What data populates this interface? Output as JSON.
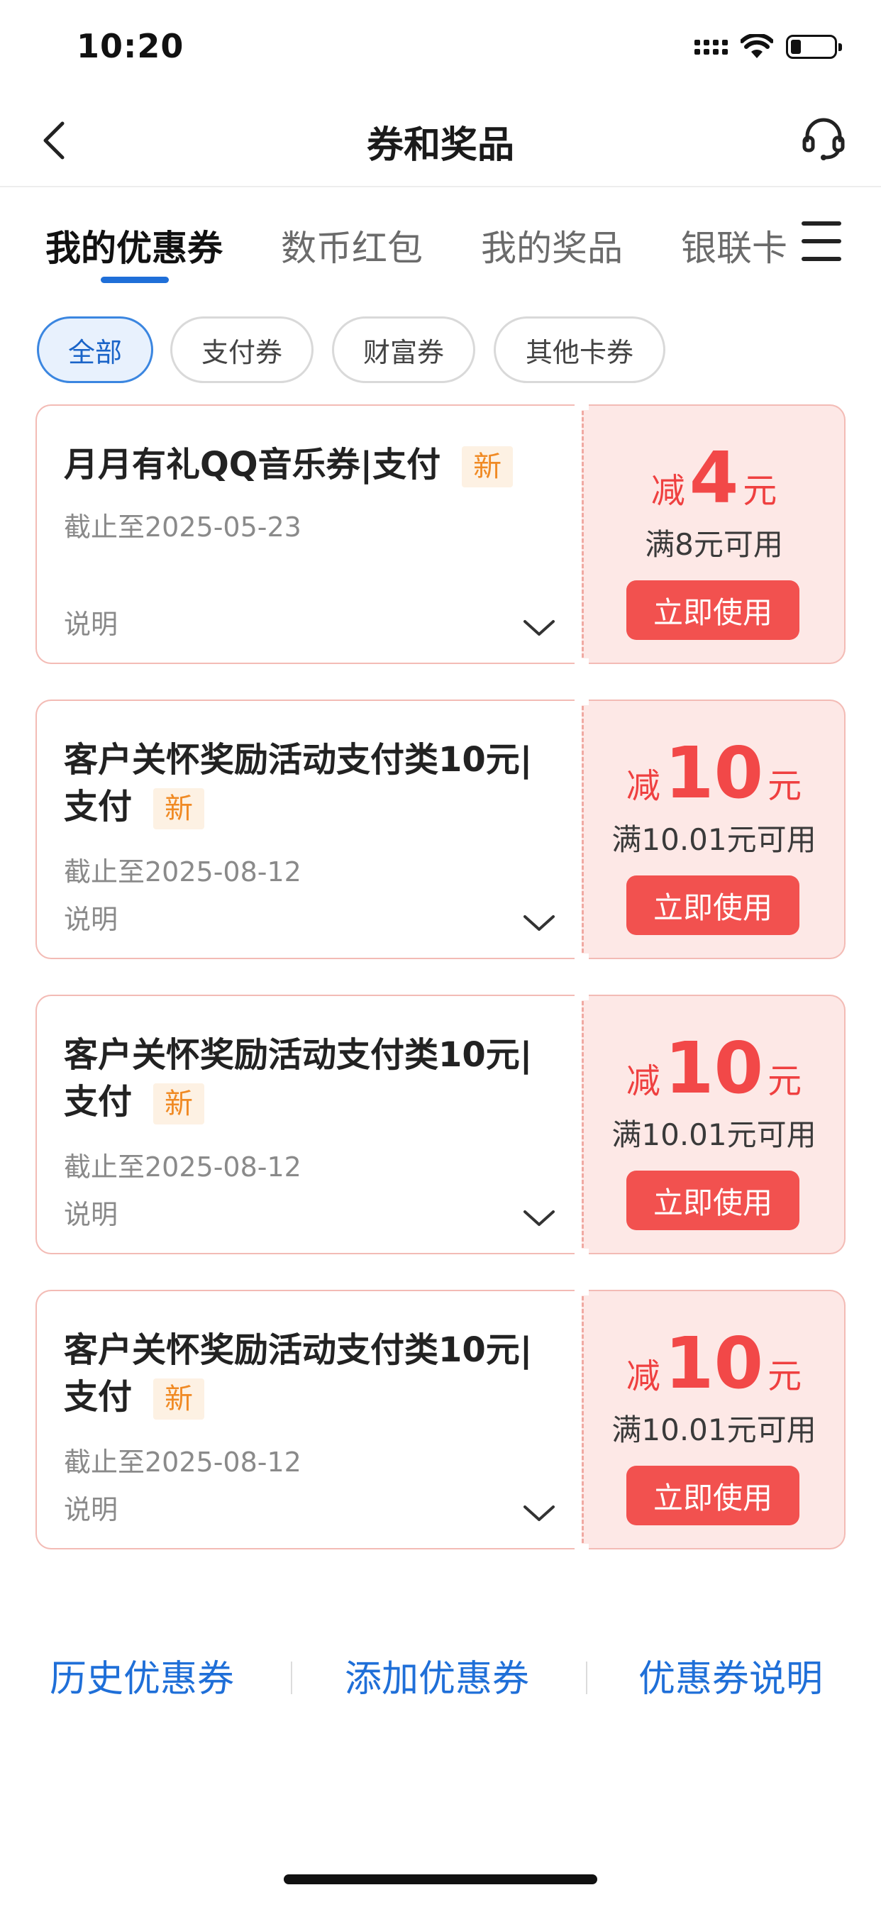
{
  "status_bar": {
    "time": "10:20"
  },
  "nav": {
    "title": "券和奖品"
  },
  "tabs": [
    {
      "label": "我的优惠券",
      "active": true
    },
    {
      "label": "数币红包",
      "active": false
    },
    {
      "label": "我的奖品",
      "active": false
    },
    {
      "label": "银联卡",
      "active": false
    }
  ],
  "filters": [
    {
      "label": "全部",
      "active": true
    },
    {
      "label": "支付券",
      "active": false
    },
    {
      "label": "财富券",
      "active": false
    },
    {
      "label": "其他卡券",
      "active": false
    }
  ],
  "coupons": [
    {
      "title": "月月有礼QQ音乐券|支付",
      "badge": "新",
      "expiry": "截止至2025-05-23",
      "desc": "说明",
      "prefix": "减",
      "amount": "4",
      "unit": "元",
      "condition": "满8元可用",
      "button": "立即使用"
    },
    {
      "title": "客户关怀奖励活动支付类10元|支付",
      "badge": "新",
      "expiry": "截止至2025-08-12",
      "desc": "说明",
      "prefix": "减",
      "amount": "10",
      "unit": "元",
      "condition": "满10.01元可用",
      "button": "立即使用"
    },
    {
      "title": "客户关怀奖励活动支付类10元|支付",
      "badge": "新",
      "expiry": "截止至2025-08-12",
      "desc": "说明",
      "prefix": "减",
      "amount": "10",
      "unit": "元",
      "condition": "满10.01元可用",
      "button": "立即使用"
    },
    {
      "title": "客户关怀奖励活动支付类10元|支付",
      "badge": "新",
      "expiry": "截止至2025-08-12",
      "desc": "说明",
      "prefix": "减",
      "amount": "10",
      "unit": "元",
      "condition": "满10.01元可用",
      "button": "立即使用"
    }
  ],
  "bottom_links": {
    "history": "历史优惠券",
    "add": "添加优惠券",
    "info": "优惠券说明"
  },
  "colors": {
    "accent_blue": "#1f6fd8",
    "coupon_red": "#f2514f",
    "coupon_bg": "#fde8e6",
    "badge_orange": "#f08a24"
  },
  "icons": [
    "back-arrow-icon",
    "headset-support-icon",
    "menu-icon",
    "chevron-down-icon",
    "wifi-icon",
    "battery-icon",
    "cellular-signal-icon"
  ]
}
